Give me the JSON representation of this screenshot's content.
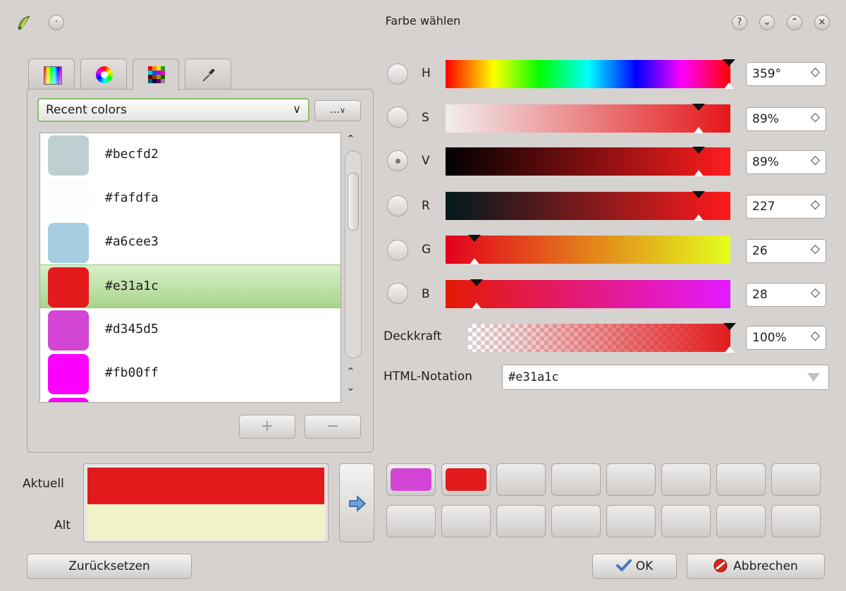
{
  "window": {
    "title": "Farbe wählen",
    "title_buttons": [
      "?",
      "⌄",
      "⌃",
      "×"
    ]
  },
  "tabs": [
    {
      "name": "color-ramp-tab",
      "icon": "gradient-square-icon"
    },
    {
      "name": "color-wheel-tab",
      "icon": "color-wheel-icon"
    },
    {
      "name": "swatches-tab",
      "icon": "color-grid-icon",
      "active": true
    },
    {
      "name": "picker-tab",
      "icon": "eyedropper-icon"
    }
  ],
  "scheme": {
    "selected": "Recent colors",
    "menu_label": "…",
    "arrow": "∨"
  },
  "recent_colors": [
    {
      "hex": "#becfd2"
    },
    {
      "hex": "#fafdfa"
    },
    {
      "hex": "#a6cee3"
    },
    {
      "hex": "#e31a1c",
      "selected": true
    },
    {
      "hex": "#d345d5"
    },
    {
      "hex": "#fb00ff"
    }
  ],
  "list_buttons": {
    "add": "+",
    "remove": "−"
  },
  "channels": {
    "h": {
      "label": "H",
      "value": "359°",
      "level": 0.997
    },
    "s": {
      "label": "S",
      "value": "89%",
      "level": 0.89
    },
    "v": {
      "label": "V",
      "value": "89%",
      "level": 0.89,
      "checked": true
    },
    "r": {
      "label": "R",
      "value": "227",
      "level": 0.89
    },
    "g": {
      "label": "G",
      "value": "26",
      "level": 0.102
    },
    "b": {
      "label": "B",
      "value": "28",
      "level": 0.11
    }
  },
  "opacity": {
    "label": "Deckkraft",
    "value": "100%",
    "level": 1.0
  },
  "html_notation": {
    "label": "HTML-Notation",
    "value": "#e31a1c"
  },
  "preview": {
    "current_label": "Aktuell",
    "old_label": "Alt",
    "current_color": "#e31a1c",
    "old_color": "#f1f3c8"
  },
  "color_buttons": [
    "#d345d5",
    "#e31a1c",
    "",
    "",
    "",
    "",
    "",
    "",
    "",
    "",
    "",
    "",
    "",
    "",
    "",
    ""
  ],
  "buttons": {
    "reset": "Zurücksetzen",
    "ok": "OK",
    "cancel": "Abbrechen"
  },
  "spin_arrows": "◇"
}
